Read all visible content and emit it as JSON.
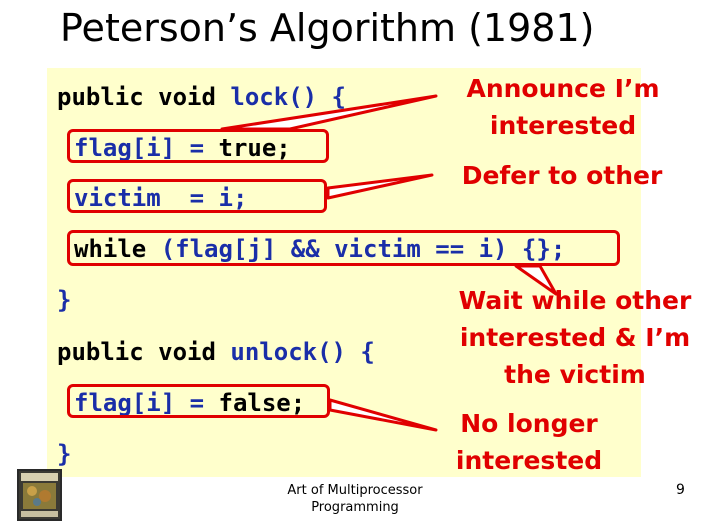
{
  "slide": {
    "title": "Peterson’s Algorithm (1981)",
    "footer_line1": "Art of Multiprocessor",
    "footer_line2": "Programming",
    "page_number": "9"
  },
  "code": {
    "line1_kw": "public void ",
    "line1_fn": "lock() {",
    "line2_a": "flag[i] = ",
    "line2_b": "true;",
    "line3": "victim  = i;",
    "line4_a": "while ",
    "line4_b": "(flag[j] && victim == i) {};",
    "line5": "}",
    "line6_kw": "public void ",
    "line6_fn": "unlock() {",
    "line7_a": "flag[i] = ",
    "line7_b": "false;",
    "line8": "}"
  },
  "annotations": {
    "announce_1": "Announce I’m",
    "announce_2": "interested",
    "defer": "Defer to other",
    "wait_1": "Wait while other",
    "wait_2": "interested & I’m",
    "wait_3": "the victim",
    "nolonger_1": "No longer",
    "nolonger_2": "interested"
  },
  "colors": {
    "highlight": "#e00000",
    "code_keyword": "#000000",
    "code_identifier": "#1a2ea8",
    "code_background": "#ffffcc"
  }
}
